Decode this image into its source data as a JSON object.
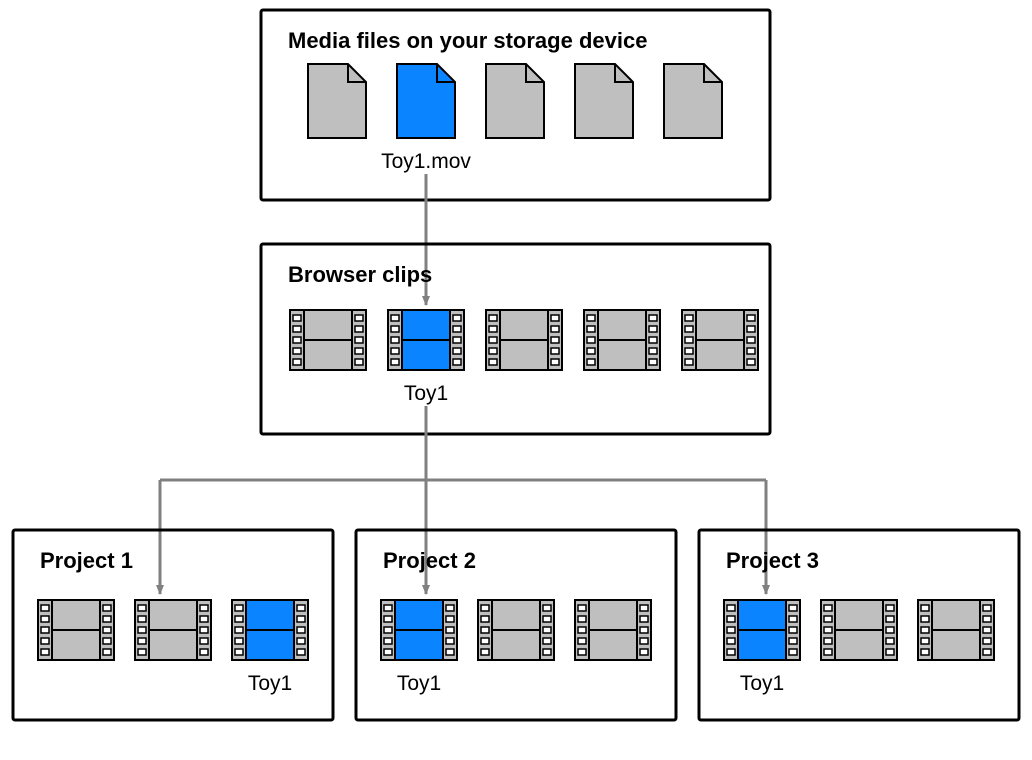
{
  "colors": {
    "grey_fill": "#bfbfbf",
    "blue_fill": "#0a84ff",
    "stroke": "#000000",
    "arrow": "#808080"
  },
  "storage": {
    "title": "Media files on your storage device",
    "file_label": "Toy1.mov"
  },
  "browser": {
    "title": "Browser clips",
    "clip_label": "Toy1"
  },
  "projects": [
    {
      "title": "Project 1",
      "clip_label": "Toy1"
    },
    {
      "title": "Project 2",
      "clip_label": "Toy1"
    },
    {
      "title": "Project 3",
      "clip_label": "Toy1"
    }
  ]
}
